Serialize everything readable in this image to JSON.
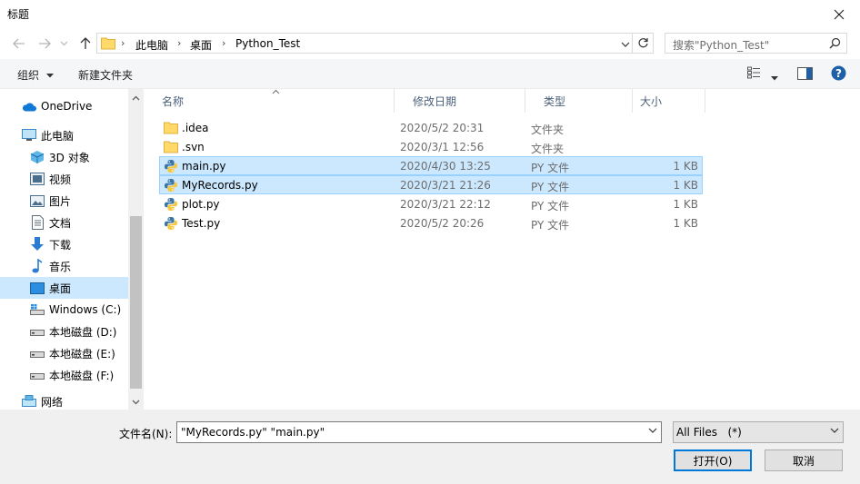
{
  "window": {
    "title": "标题",
    "close_icon": "close-icon"
  },
  "nav": {
    "breadcrumbs": [
      "此电脑",
      "桌面",
      "Python_Test"
    ],
    "search_placeholder": "搜索\"Python_Test\""
  },
  "toolbar": {
    "organize_label": "组织",
    "new_folder_label": "新建文件夹"
  },
  "sidebar": {
    "items": [
      {
        "label": "OneDrive",
        "icon": "cloud-icon"
      },
      {
        "label": "此电脑",
        "icon": "computer-icon"
      },
      {
        "label": "3D 对象",
        "icon": "cube-icon"
      },
      {
        "label": "视频",
        "icon": "video-icon"
      },
      {
        "label": "图片",
        "icon": "picture-icon"
      },
      {
        "label": "文档",
        "icon": "document-icon"
      },
      {
        "label": "下载",
        "icon": "download-icon"
      },
      {
        "label": "音乐",
        "icon": "music-icon"
      },
      {
        "label": "桌面",
        "icon": "desktop-icon",
        "selected": true
      },
      {
        "label": "Windows (C:)",
        "icon": "drive-icon"
      },
      {
        "label": "本地磁盘 (D:)",
        "icon": "drive-icon"
      },
      {
        "label": "本地磁盘 (E:)",
        "icon": "drive-icon"
      },
      {
        "label": "本地磁盘 (F:)",
        "icon": "drive-icon"
      },
      {
        "label": "网络",
        "icon": "network-icon"
      }
    ]
  },
  "columns": [
    "名称",
    "修改日期",
    "类型",
    "大小"
  ],
  "files": [
    {
      "name": ".idea",
      "date": "2020/5/2 20:31",
      "type": "文件夹",
      "size": "",
      "icon": "folder-icon",
      "selected": false
    },
    {
      "name": ".svn",
      "date": "2020/3/1 12:56",
      "type": "文件夹",
      "size": "",
      "icon": "folder-icon",
      "selected": false
    },
    {
      "name": "main.py",
      "date": "2020/4/30 13:25",
      "type": "PY 文件",
      "size": "1 KB",
      "icon": "python-file-icon",
      "selected": true
    },
    {
      "name": "MyRecords.py",
      "date": "2020/3/21 21:26",
      "type": "PY 文件",
      "size": "1 KB",
      "icon": "python-file-icon",
      "selected": true
    },
    {
      "name": "plot.py",
      "date": "2020/3/21 22:12",
      "type": "PY 文件",
      "size": "1 KB",
      "icon": "python-file-icon",
      "selected": false
    },
    {
      "name": "Test.py",
      "date": "2020/5/2 20:26",
      "type": "PY 文件",
      "size": "1 KB",
      "icon": "python-file-icon",
      "selected": false
    }
  ],
  "bottom": {
    "filename_label": "文件名(N):",
    "filename_value": "\"MyRecords.py\" \"main.py\"",
    "filter_value": "All Files   (*)",
    "open_label": "打开(O)",
    "cancel_label": "取消"
  },
  "colors": {
    "selection": "#cce8ff",
    "selection_border": "#99d1ff",
    "accent": "#0078d7"
  }
}
